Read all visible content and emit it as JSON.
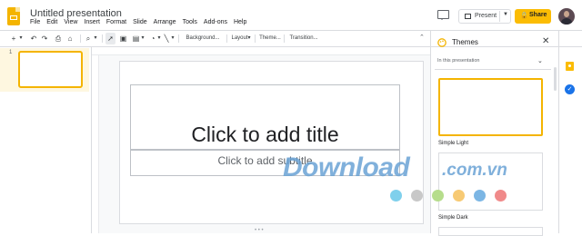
{
  "header": {
    "doc_title": "Untitled presentation",
    "menu": [
      "File",
      "Edit",
      "View",
      "Insert",
      "Format",
      "Slide",
      "Arrange",
      "Tools",
      "Add-ons",
      "Help"
    ],
    "present_label": "Present",
    "share_label": "Share"
  },
  "toolbar": {
    "background_label": "Background...",
    "layout_label": "Layout▾",
    "theme_label": "Theme...",
    "transition_label": "Transition..."
  },
  "filmstrip": {
    "slide_number": "1"
  },
  "slide": {
    "title_placeholder": "Click to add title",
    "subtitle_placeholder": "Click to add subtitle"
  },
  "themes_panel": {
    "title": "Themes",
    "section_label": "In this presentation",
    "themes": [
      {
        "label": "Simple Light"
      },
      {
        "label": "Simple Dark"
      }
    ]
  },
  "watermark": {
    "text": "Download",
    "suffix": ".com.vn",
    "dot_colors": [
      "#7fd0ec",
      "#c8c8c8",
      "#b6dd8c",
      "#f7ca74",
      "#7cb6e4",
      "#f08a8a"
    ]
  },
  "colors": {
    "accent": "#f4b400",
    "share": "#fbbc04"
  }
}
